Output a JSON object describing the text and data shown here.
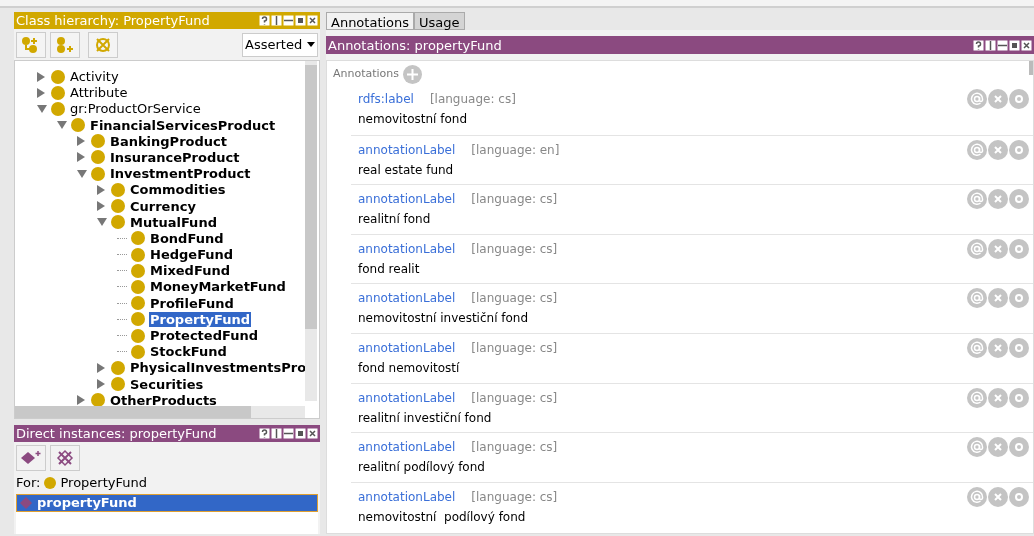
{
  "class_hierarchy": {
    "title": "Class hierarchy: PropertyFund",
    "view": "Asserted",
    "tree": [
      {
        "label": "Activity",
        "bold": false,
        "expanded": false,
        "selected": false
      },
      {
        "label": "Attribute",
        "bold": false,
        "expanded": false,
        "selected": false
      },
      {
        "label": "gr:ProductOrService",
        "bold": false,
        "expanded": true,
        "selected": false,
        "children": [
          {
            "label": "FinancialServicesProduct",
            "bold": true,
            "expanded": true,
            "selected": false,
            "children": [
              {
                "label": "BankingProduct",
                "bold": true,
                "expanded": false,
                "selected": false
              },
              {
                "label": "InsuranceProduct",
                "bold": true,
                "expanded": false,
                "selected": false
              },
              {
                "label": "InvestmentProduct",
                "bold": true,
                "expanded": true,
                "selected": false,
                "children": [
                  {
                    "label": "Commodities",
                    "bold": true,
                    "expanded": false,
                    "selected": false
                  },
                  {
                    "label": "Currency",
                    "bold": true,
                    "expanded": false,
                    "selected": false
                  },
                  {
                    "label": "MutualFund",
                    "bold": true,
                    "expanded": true,
                    "selected": false,
                    "children": [
                      {
                        "label": "BondFund",
                        "bold": true,
                        "selected": false
                      },
                      {
                        "label": "HedgeFund",
                        "bold": true,
                        "selected": false
                      },
                      {
                        "label": "MixedFund",
                        "bold": true,
                        "selected": false
                      },
                      {
                        "label": "MoneyMarketFund",
                        "bold": true,
                        "selected": false
                      },
                      {
                        "label": "ProfileFund",
                        "bold": true,
                        "selected": false
                      },
                      {
                        "label": "PropertyFund",
                        "bold": true,
                        "selected": true
                      },
                      {
                        "label": "ProtectedFund",
                        "bold": true,
                        "selected": false
                      },
                      {
                        "label": "StockFund",
                        "bold": true,
                        "selected": false
                      }
                    ]
                  },
                  {
                    "label": "PhysicalInvestmentsPro",
                    "bold": true,
                    "expanded": false,
                    "selected": false
                  },
                  {
                    "label": "Securities",
                    "bold": true,
                    "expanded": false,
                    "selected": false
                  }
                ]
              },
              {
                "label": "OtherProducts",
                "bold": true,
                "expanded": false,
                "selected": false
              }
            ]
          }
        ]
      }
    ]
  },
  "direct_instances": {
    "title": "Direct instances: propertyFund",
    "for_label": "For:",
    "for_class": "PropertyFund",
    "instances": [
      {
        "label": "propertyFund",
        "selected": true
      }
    ]
  },
  "tabs": [
    {
      "label": "Annotations",
      "selected": true
    },
    {
      "label": "Usage",
      "selected": false
    }
  ],
  "annotations": {
    "title": "Annotations: propertyFund",
    "header": "Annotations",
    "rows": [
      {
        "property": "rdfs:label",
        "language": "[language: cs]",
        "value": "nemovitostní fond"
      },
      {
        "property": "annotationLabel",
        "language": "[language: en]",
        "value": "real estate fund"
      },
      {
        "property": "annotationLabel",
        "language": "[language: cs]",
        "value": "realitní fond"
      },
      {
        "property": "annotationLabel",
        "language": "[language: cs]",
        "value": "fond realit"
      },
      {
        "property": "annotationLabel",
        "language": "[language: cs]",
        "value": "nemovitostní investiční fond"
      },
      {
        "property": "annotationLabel",
        "language": "[language: cs]",
        "value": "fond nemovitostí"
      },
      {
        "property": "annotationLabel",
        "language": "[language: cs]",
        "value": "realitní investiční fond"
      },
      {
        "property": "annotationLabel",
        "language": "[language: cs]",
        "value": "realitní podílový fond"
      },
      {
        "property": "annotationLabel",
        "language": "[language: cs]",
        "value": "nemovitostní  podílový fond"
      }
    ]
  }
}
